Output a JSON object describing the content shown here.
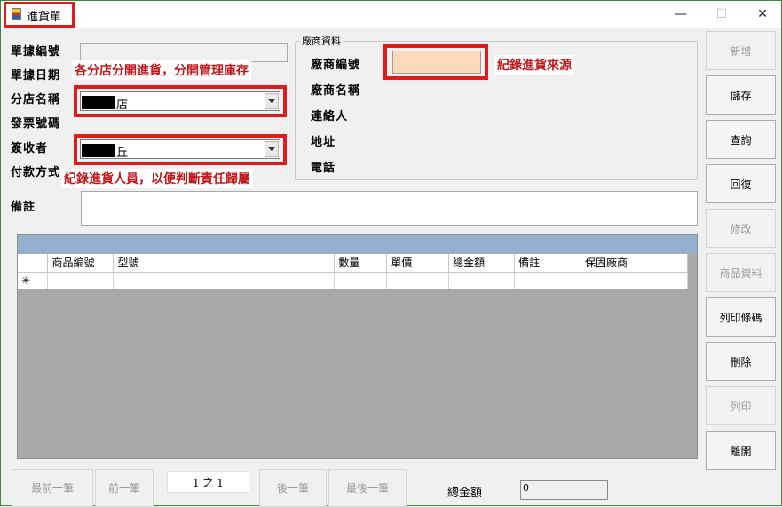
{
  "window": {
    "title": "進貨單",
    "minimize_glyph": "—",
    "maximize_glyph": "☐",
    "close_glyph": "✕"
  },
  "form": {
    "labels": {
      "doc_no": "單據編號",
      "doc_date": "單據日期",
      "branch": "分店名稱",
      "invoice": "發票號碼",
      "receiver": "簽收者",
      "payment": "付款方式",
      "remark": "備註"
    },
    "branch_value": "店",
    "receiver_value": "丘"
  },
  "supplier": {
    "group_title": "廠商資料",
    "labels": {
      "code": "廠商編號",
      "name": "廠商名稱",
      "contact": "連絡人",
      "address": "地址",
      "phone": "電話"
    }
  },
  "annotations": {
    "branch_note": "各分店分開進貨，分開管理庫存",
    "receiver_note": "紀錄進貨人員，以便判斷責任歸屬",
    "supplier_note": "紀錄進貨來源",
    "highlight_color": "#e01b1b"
  },
  "sidebar": {
    "buttons": [
      {
        "label": "新增",
        "enabled": false
      },
      {
        "label": "儲存",
        "enabled": true
      },
      {
        "label": "查詢",
        "enabled": true
      },
      {
        "label": "回復",
        "enabled": true
      },
      {
        "label": "修改",
        "enabled": false
      },
      {
        "label": "商品資料",
        "enabled": false
      },
      {
        "label": "列印條碼",
        "enabled": true
      },
      {
        "label": "刪除",
        "enabled": true
      },
      {
        "label": "列印",
        "enabled": false
      },
      {
        "label": "離開",
        "enabled": true
      }
    ]
  },
  "grid": {
    "columns": [
      "",
      "商品編號",
      "型號",
      "數量",
      "單價",
      "總金額",
      "備註",
      "保固廠商"
    ],
    "new_row_marker": "✳"
  },
  "footer": {
    "first": "最前一筆",
    "prev": "前一筆",
    "page": "1 之 1",
    "next": "後一筆",
    "last": "最後一筆",
    "total_label": "總金額",
    "total_value": "0"
  },
  "colors": {
    "supplier_code_field": "#fcd9b8",
    "grid_caption": "#93b0cf",
    "grid_background": "#a9a9a9"
  }
}
